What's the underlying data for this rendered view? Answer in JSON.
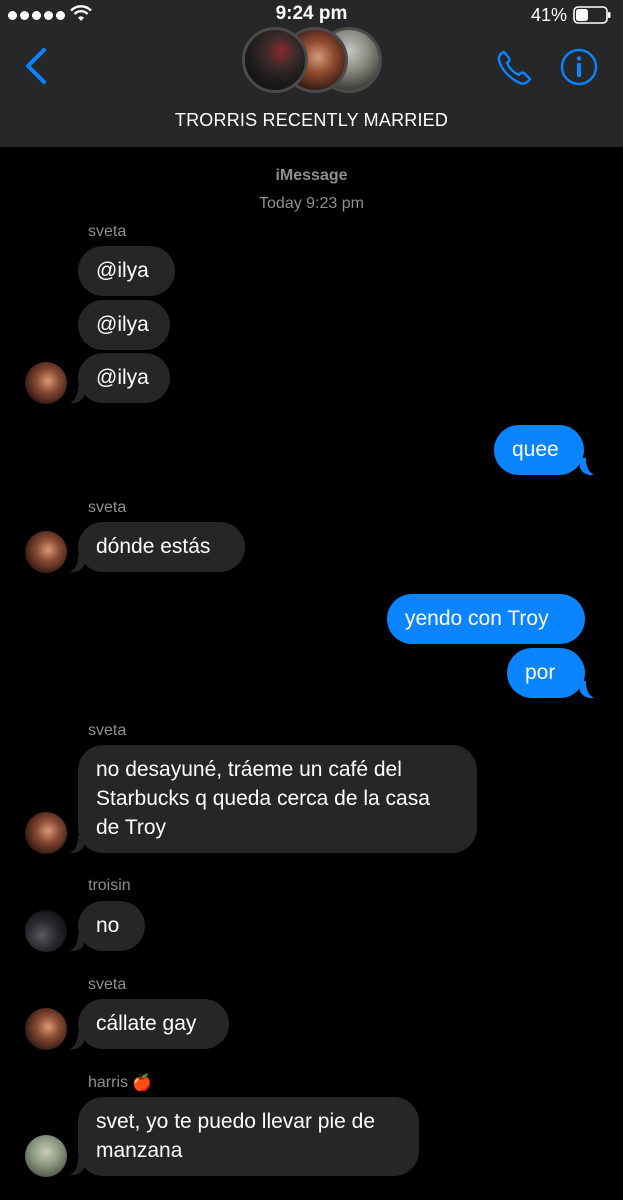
{
  "status_bar": {
    "time": "9:24 pm",
    "battery_percent": "41%",
    "battery_level": 0.41,
    "signal_bars": 5
  },
  "header": {
    "title": "TRORRIS RECENTLY MARRIED",
    "back_icon": "chevron-left-icon",
    "call_icon": "phone-icon",
    "info_icon": "info-icon",
    "accent_color": "#0a84ff"
  },
  "conversation": {
    "service_label": "iMessage",
    "timestamp": "Today 9:23 pm"
  },
  "messages": {
    "sender_1": "sveta",
    "m1": "@ilya",
    "m2": "@ilya",
    "m3": "@ilya",
    "m4": "quee",
    "sender_2": "sveta",
    "m5": "dónde estás",
    "m6": "yendo con Troy",
    "m7": "por",
    "sender_3": "sveta",
    "m8": "no desayuné, tráeme un café del\nStarbucks q queda cerca de la casa\nde Troy",
    "sender_4": "troisin",
    "m9": "no",
    "sender_5": "sveta",
    "m10": "cállate gay",
    "sender_6": "harris",
    "sender_6_emoji": "🍎",
    "m11": "svet, yo te puedo llevar pie de\nmanzana"
  },
  "colors": {
    "incoming_bubble": "#262629",
    "outgoing_bubble": "#0a84ff",
    "header_background": "#272729",
    "meta_text": "#8e8e93"
  }
}
